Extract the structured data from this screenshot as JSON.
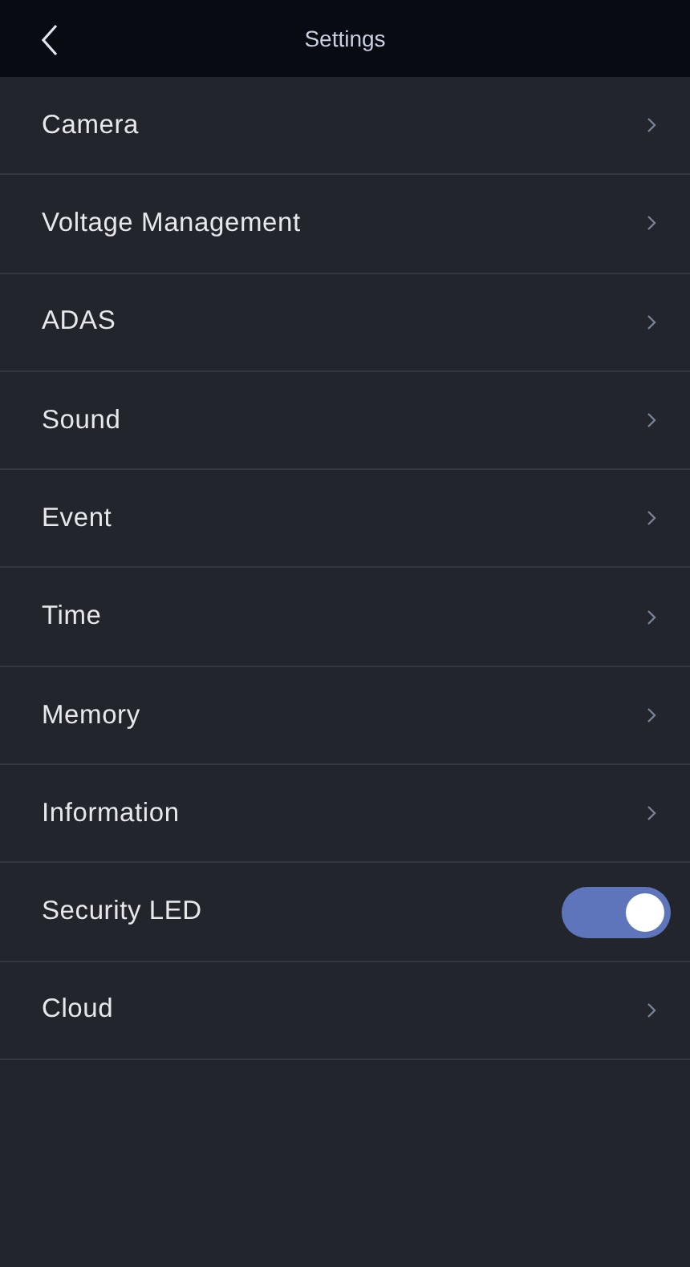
{
  "header": {
    "title": "Settings"
  },
  "items": [
    {
      "label": "Camera",
      "kind": "link"
    },
    {
      "label": "Voltage Management",
      "kind": "link"
    },
    {
      "label": "ADAS",
      "kind": "link"
    },
    {
      "label": "Sound",
      "kind": "link"
    },
    {
      "label": "Event",
      "kind": "link"
    },
    {
      "label": "Time",
      "kind": "link"
    },
    {
      "label": "Memory",
      "kind": "link"
    },
    {
      "label": "Information",
      "kind": "link"
    },
    {
      "label": "Security LED",
      "kind": "toggle",
      "on": true
    },
    {
      "label": "Cloud",
      "kind": "link"
    }
  ]
}
